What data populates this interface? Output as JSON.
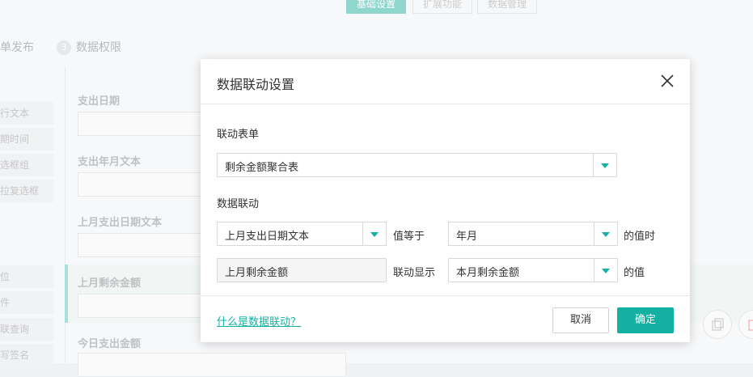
{
  "background": {
    "top_tabs": [
      "基础设置",
      "扩展功能",
      "数据管理"
    ],
    "steps": [
      {
        "num": "",
        "label": "单发布"
      },
      {
        "num": "3",
        "label": "数据权限"
      }
    ],
    "sidebar_items": [
      "行文本",
      "期时间",
      "选框组",
      "拉复选框",
      "位",
      "件",
      "联查询",
      "写签名"
    ],
    "field_labels": [
      "支出日期",
      "支出年月文本",
      "上月支出日期文本",
      "上月剩余金额",
      "今日支出金额"
    ]
  },
  "dialog": {
    "title": "数据联动设置",
    "close_icon": "close-icon",
    "linked_form_label": "联动表单",
    "linked_form_value": "剩余金额聚合表",
    "data_link_label": "数据联动",
    "rule1": {
      "source_field": "上月支出日期文本",
      "operator": "值等于",
      "target_field": "年月",
      "suffix": "的值时"
    },
    "rule2": {
      "source_field": "上月剩余金额",
      "operator": "联动显示",
      "target_field": "本月剩余金额",
      "suffix": "的值"
    },
    "help_link": "什么是数据联动？",
    "cancel_label": "取消",
    "ok_label": "确定"
  },
  "colors": {
    "accent": "#14b1a3"
  }
}
